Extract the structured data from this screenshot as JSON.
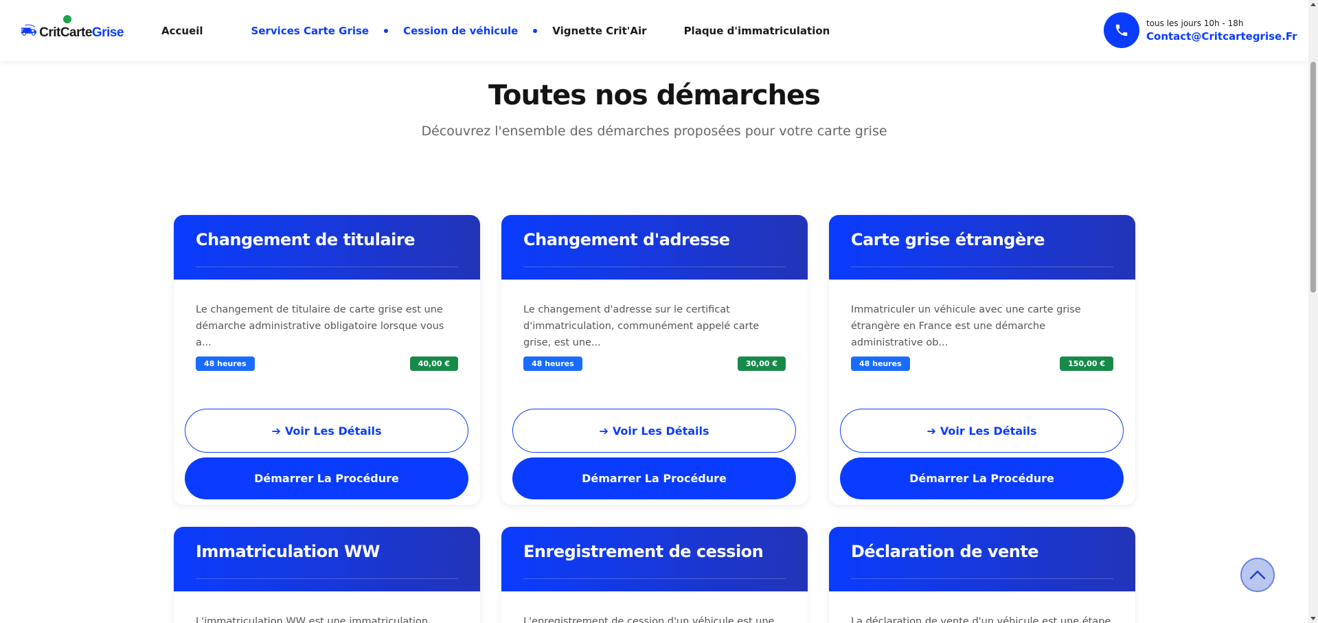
{
  "header": {
    "logo": {
      "text_part1": "Crit",
      "text_part2": "Carte",
      "text_part3": "Grise"
    },
    "nav": [
      {
        "label": "Accueil"
      },
      {
        "label": "Services Carte Grise"
      },
      {
        "label": "Cession de véhicule"
      },
      {
        "label": "Vignette Crit'Air"
      },
      {
        "label": "Plaque d'immatriculation"
      }
    ],
    "contact": {
      "hours": "tous les jours 10h - 18h",
      "email": "Contact@Critcartegrise.Fr"
    }
  },
  "section": {
    "title": "Toutes nos démarches",
    "subtitle": "Découvrez l'ensemble des démarches proposées pour votre carte grise"
  },
  "cards": [
    {
      "title": "Changement de titulaire",
      "description": "Le changement de titulaire de carte grise est une démarche administrative obligatoire lorsque vous a...",
      "time": "48 heures",
      "price": "40,00 €",
      "details_label": "Voir Les Détails",
      "start_label": "Démarrer La Procédure"
    },
    {
      "title": "Changement d'adresse",
      "description": "Le changement d'adresse sur le certificat d'immatriculation, communément appelé carte grise, est une...",
      "time": "48 heures",
      "price": "30,00 €",
      "details_label": "Voir Les Détails",
      "start_label": "Démarrer La Procédure"
    },
    {
      "title": "Carte grise étrangère",
      "description": "Immatriculer un véhicule avec une carte grise étrangère en France est une démarche administrative ob...",
      "time": "48 heures",
      "price": "150,00 €",
      "details_label": "Voir Les Détails",
      "start_label": "Démarrer La Procédure"
    },
    {
      "title": "Immatriculation WW",
      "description": "L'immatriculation WW est une immatriculation"
    },
    {
      "title": "Enregistrement de cession",
      "description": "L'enregistrement de cession d'un véhicule est une"
    },
    {
      "title": "Déclaration de vente",
      "description": "La déclaration de vente d'un véhicule est une étape"
    }
  ],
  "icons": {
    "phone": "phone-icon",
    "arrow": "arrow-right-icon",
    "to_top": "chevron-up-icon"
  },
  "colors": {
    "brand_blue": "#0a3cff",
    "card_gradient_end": "#2334b8",
    "time_badge": "#1a6cff",
    "price_badge": "#178a4a"
  }
}
